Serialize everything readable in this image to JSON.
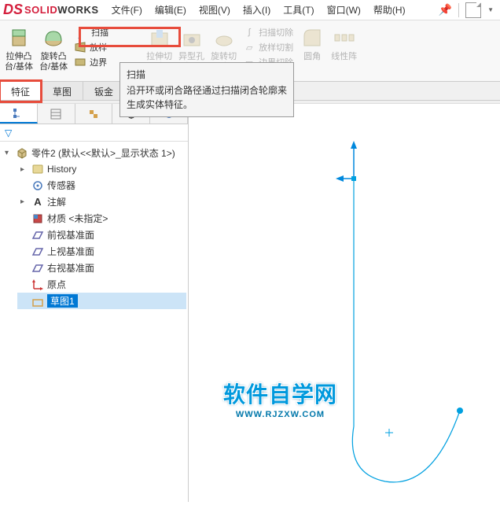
{
  "logo": {
    "solid": "SOLID",
    "works": "WORKS"
  },
  "menu": {
    "file": "文件(F)",
    "edit": "编辑(E)",
    "view": "视图(V)",
    "insert": "插入(I)",
    "tools": "工具(T)",
    "window": "窗口(W)",
    "help": "帮助(H)"
  },
  "ribbon": {
    "extrude": "拉伸凸\n台/基体",
    "revolve": "旋转凸\n台/基体",
    "sweep": "扫描",
    "loft": "放样",
    "boundary": "边界",
    "cut_sweep": "扫描切除",
    "cut_loft": "放样切割",
    "cut_boundary": "边界切除",
    "hole": "异型孔\n向导",
    "extrude_cut": "拉伸切\n除",
    "revolve_cut": "旋转切\n除",
    "fillet": "圆角",
    "linear_pattern": "线性阵"
  },
  "tooltip": {
    "title": "扫描",
    "desc": "沿开环或闭合路径通过扫描闭合轮廓来生成实体特征。"
  },
  "tabs": {
    "feature": "特征",
    "sketch": "草图",
    "sheetmetal": "钣金"
  },
  "tree": {
    "root": "零件2 (默认<<默认>_显示状态 1>)",
    "history": "History",
    "sensors": "传感器",
    "annotations": "注解",
    "material": "材质 <未指定>",
    "front_plane": "前视基准面",
    "top_plane": "上视基准面",
    "right_plane": "右视基准面",
    "origin": "原点",
    "sketch1": "草图1"
  },
  "watermark": {
    "cn": "软件自学网",
    "url": "WWW.RJZXW.COM"
  }
}
